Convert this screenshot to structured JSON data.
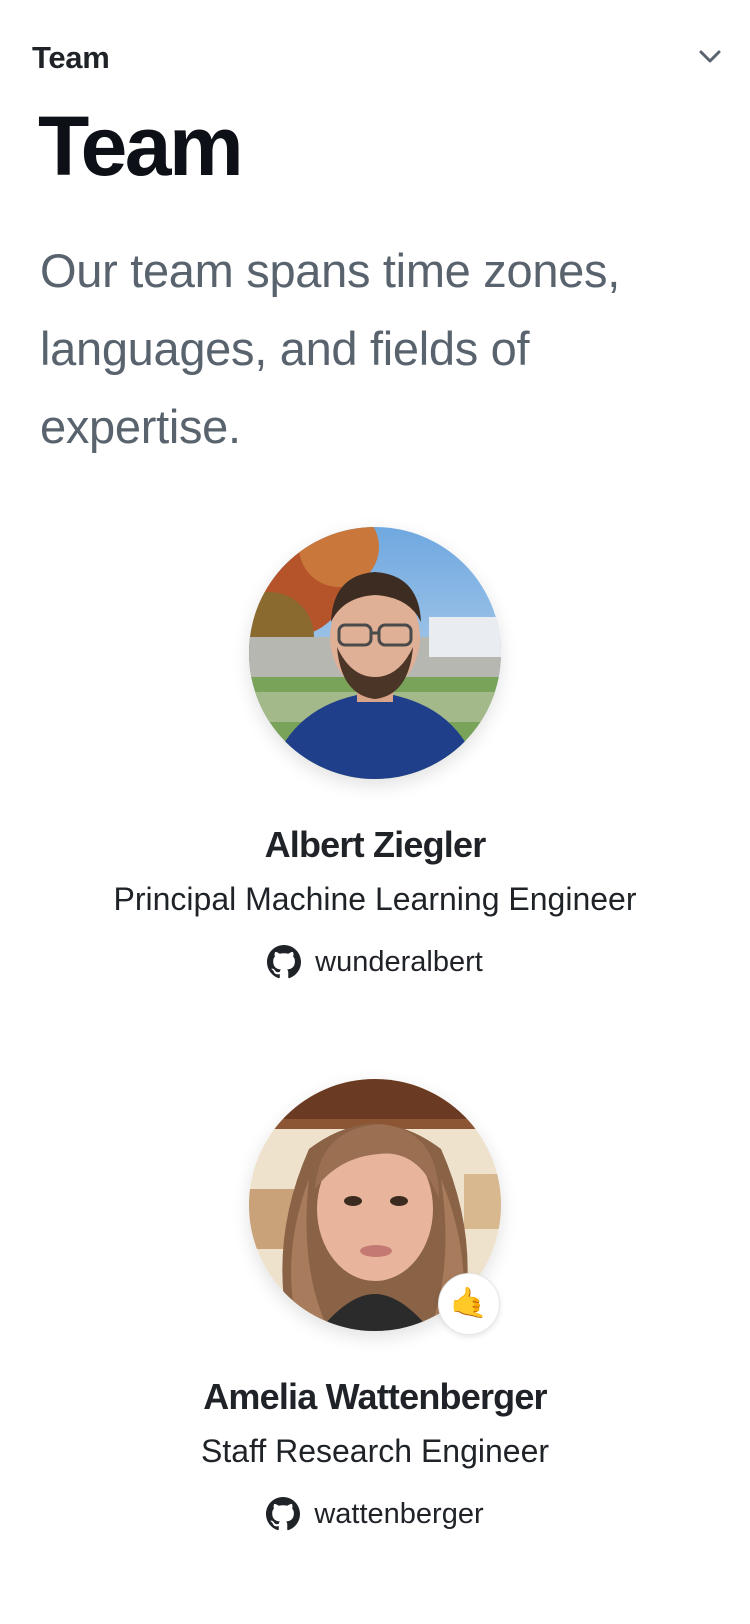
{
  "header": {
    "title": "Team",
    "toggle_icon": "chevron-down-icon"
  },
  "hero": {
    "title": "Team",
    "description": "Our team spans time zones, languages, and fields of expertise."
  },
  "members": [
    {
      "name": "Albert Ziegler",
      "role": "Principal Machine Learning Engineer",
      "github": "wunderalbert",
      "github_icon": "github-icon"
    },
    {
      "name": "Amelia Wattenberger",
      "role": "Staff Research Engineer",
      "github": "wattenberger",
      "github_icon": "github-icon",
      "status_emoji": "🤙"
    }
  ],
  "colors": {
    "text_primary": "#1f2328",
    "text_secondary": "#59636e",
    "heading": "#0d1117",
    "background": "#ffffff"
  }
}
